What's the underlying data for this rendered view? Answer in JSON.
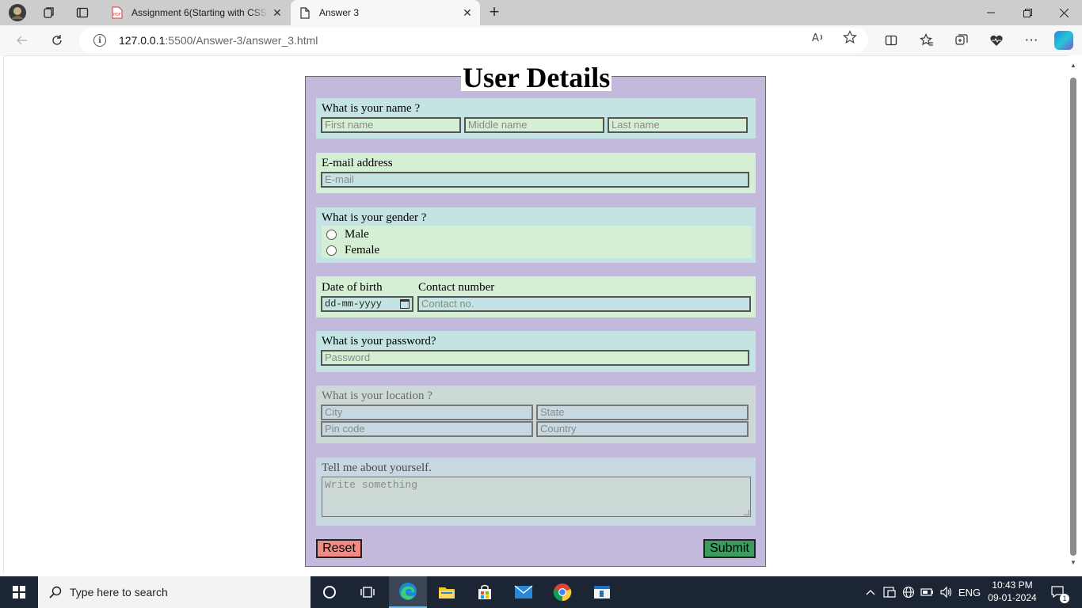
{
  "browser": {
    "tabs": [
      {
        "title": "Assignment 6(Starting with CSS)",
        "icon": "pdf-icon",
        "active": false
      },
      {
        "title": "Answer 3",
        "icon": "page-icon",
        "active": true
      }
    ],
    "url_host": "127.0.0.1",
    "url_path": ":5500/Answer-3/answer_3.html"
  },
  "form": {
    "legend": "User Details",
    "name": {
      "label": "What is your name ?",
      "first_placeholder": "First name",
      "middle_placeholder": "Middle name",
      "last_placeholder": "Last name"
    },
    "email": {
      "label": "E-mail address",
      "placeholder": "E-mail"
    },
    "gender": {
      "label": "What is your gender ?",
      "options": [
        "Male",
        "Female"
      ]
    },
    "dob": {
      "label": "Date of birth",
      "placeholder": "dd-mm-yyyy"
    },
    "contact": {
      "label": "Contact number",
      "placeholder": "Contact no."
    },
    "password": {
      "label": "What is your password?",
      "placeholder": "Password"
    },
    "location": {
      "label": "What is your location ?",
      "city_placeholder": "City",
      "state_placeholder": "State",
      "pin_placeholder": "Pin code",
      "country_placeholder": "Country"
    },
    "about": {
      "label": "Tell me about yourself.",
      "placeholder": "Write something"
    },
    "reset_label": "Reset",
    "submit_label": "Submit"
  },
  "taskbar": {
    "search_placeholder": "Type here to search",
    "language": "ENG",
    "time": "10:43 PM",
    "date": "09-01-2024",
    "notification_count": "1"
  }
}
